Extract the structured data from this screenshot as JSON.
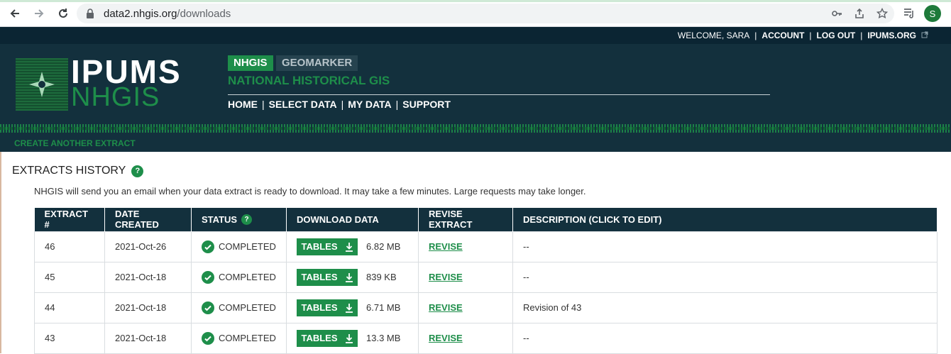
{
  "browser": {
    "url_host": "data2.nhgis.org",
    "url_path": "/downloads",
    "avatar_letter": "S"
  },
  "topbar": {
    "welcome": "WELCOME, SARA",
    "account": "ACCOUNT",
    "logout": "LOG OUT",
    "ipums_org": "IPUMS.ORG"
  },
  "logo": {
    "line1": "IPUMS",
    "line2": "NHGIS"
  },
  "tags": {
    "nhgis": "NHGIS",
    "geomarker": "GEOMARKER"
  },
  "subtitle": "NATIONAL HISTORICAL GIS",
  "nav": {
    "home": "HOME",
    "select_data": "SELECT DATA",
    "my_data": "MY DATA",
    "support": "SUPPORT"
  },
  "create_link": "CREATE ANOTHER EXTRACT",
  "page": {
    "title": "EXTRACTS HISTORY",
    "help": "?",
    "notice": "NHGIS will send you an email when your data extract is ready to download. It may take a few minutes. Large requests may take longer."
  },
  "table": {
    "headers": [
      "EXTRACT #",
      "DATE CREATED",
      "STATUS",
      "DOWNLOAD DATA",
      "REVISE EXTRACT",
      "DESCRIPTION (CLICK TO EDIT)"
    ],
    "rows": [
      {
        "extract": "46",
        "date": "2021-Oct-26",
        "status": "COMPLETED",
        "button": "TABLES",
        "size": "6.82 MB",
        "revise": "REVISE",
        "description": "--"
      },
      {
        "extract": "45",
        "date": "2021-Oct-18",
        "status": "COMPLETED",
        "button": "TABLES",
        "size": "839 KB",
        "revise": "REVISE",
        "description": "--"
      },
      {
        "extract": "44",
        "date": "2021-Oct-18",
        "status": "COMPLETED",
        "button": "TABLES",
        "size": "6.71 MB",
        "revise": "REVISE",
        "description": "Revision of 43"
      },
      {
        "extract": "43",
        "date": "2021-Oct-18",
        "status": "COMPLETED",
        "button": "TABLES",
        "size": "13.3 MB",
        "revise": "REVISE",
        "description": "--"
      }
    ]
  },
  "colors": {
    "brand_green": "#1e8e4a",
    "header_navy": "#13303d"
  }
}
